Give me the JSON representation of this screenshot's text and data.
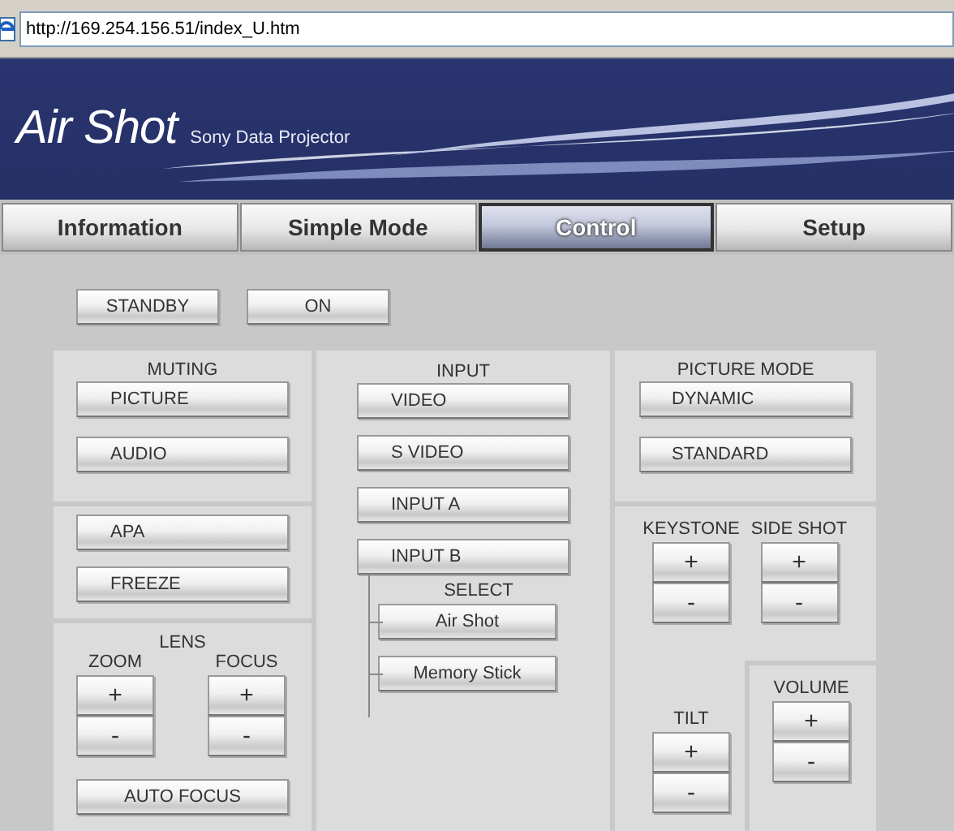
{
  "address_bar": {
    "url": "http://169.254.156.51/index_U.htm"
  },
  "banner": {
    "title": "Air Shot",
    "subtitle": "Sony Data Projector"
  },
  "tabs": [
    {
      "label": "Information",
      "selected": false
    },
    {
      "label": "Simple Mode",
      "selected": false
    },
    {
      "label": "Control",
      "selected": true
    },
    {
      "label": "Setup",
      "selected": false
    }
  ],
  "power_buttons": [
    "STANDBY",
    "ON"
  ],
  "muting": {
    "title": "MUTING",
    "buttons": [
      "PICTURE",
      "AUDIO"
    ]
  },
  "functions": {
    "buttons": [
      "APA",
      "FREEZE"
    ]
  },
  "lens": {
    "title": "LENS",
    "adjusters": [
      {
        "label": "ZOOM",
        "plus": "+",
        "minus": "-"
      },
      {
        "label": "FOCUS",
        "plus": "+",
        "minus": "-"
      }
    ],
    "auto_button": "AUTO FOCUS"
  },
  "input": {
    "title": "INPUT",
    "buttons": [
      "VIDEO",
      "S VIDEO",
      "INPUT A",
      "INPUT B"
    ],
    "select": {
      "title": "SELECT",
      "buttons": [
        "Air Shot",
        "Memory Stick"
      ]
    }
  },
  "picture_mode": {
    "title": "PICTURE MODE",
    "buttons": [
      "DYNAMIC",
      "STANDARD"
    ]
  },
  "adjust": {
    "adjusters": [
      {
        "label": "KEYSTONE",
        "plus": "+",
        "minus": "-"
      },
      {
        "label": "SIDE SHOT",
        "plus": "+",
        "minus": "-"
      },
      {
        "label": "TILT",
        "plus": "+",
        "minus": "-"
      }
    ]
  },
  "volume": {
    "label": "VOLUME",
    "plus": "+",
    "minus": "-"
  }
}
